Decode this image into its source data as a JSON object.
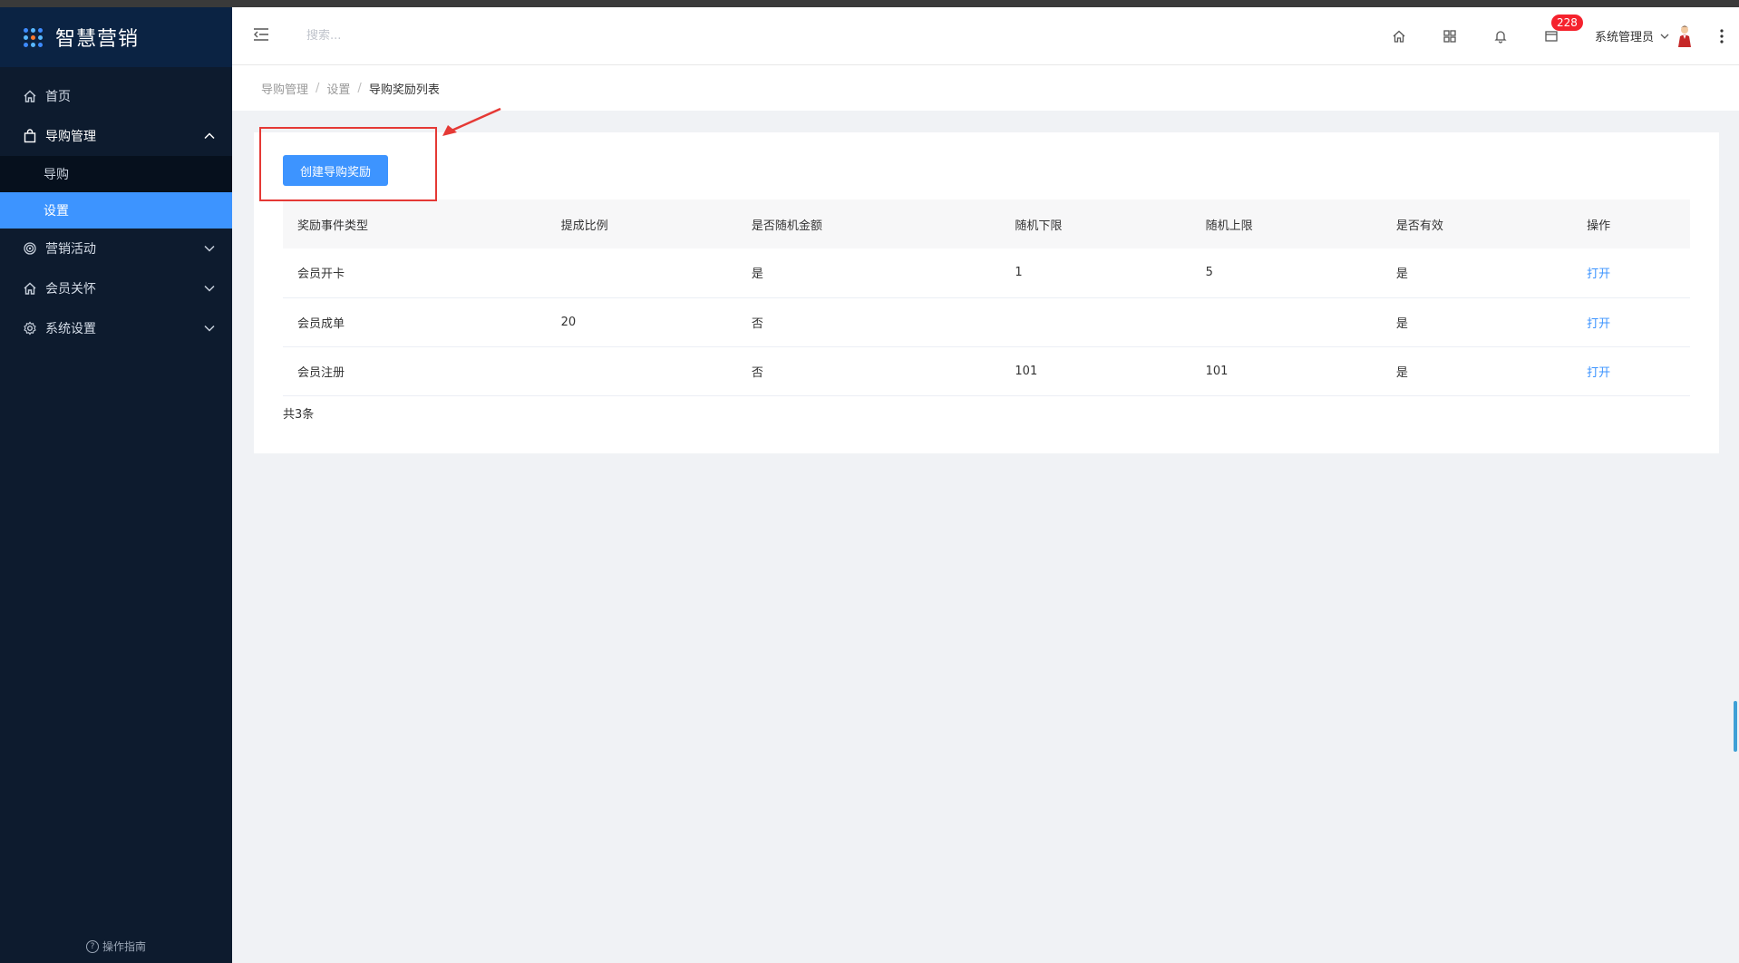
{
  "app": {
    "title": "智慧营销"
  },
  "sidebar": {
    "items": [
      {
        "label": "首页",
        "icon": "home-icon"
      },
      {
        "label": "导购管理",
        "icon": "bag-icon",
        "expanded": true,
        "children": [
          {
            "label": "导购"
          },
          {
            "label": "设置",
            "active": true
          }
        ]
      },
      {
        "label": "营销活动",
        "icon": "target-icon"
      },
      {
        "label": "会员关怀",
        "icon": "home-icon"
      },
      {
        "label": "系统设置",
        "icon": "gear-icon"
      }
    ],
    "guide": "操作指南"
  },
  "header": {
    "search_placeholder": "搜索...",
    "badge_count": "228",
    "user_name": "系统管理员"
  },
  "breadcrumb": {
    "items": [
      "导购管理",
      "设置"
    ],
    "current": "导购奖励列表"
  },
  "main": {
    "create_button": "创建导购奖励",
    "table": {
      "headers": [
        "奖励事件类型",
        "提成比例",
        "是否随机金额",
        "随机下限",
        "随机上限",
        "是否有效",
        "操作"
      ],
      "rows": [
        [
          "会员开卡",
          "",
          "是",
          "1",
          "5",
          "是",
          "打开"
        ],
        [
          "会员成单",
          "20",
          "否",
          "",
          "",
          "是",
          "打开"
        ],
        [
          "会员注册",
          "",
          "否",
          "101",
          "101",
          "是",
          "打开"
        ]
      ]
    },
    "total": "共3条"
  },
  "colors": {
    "sidebar_bg": "#0d1b2e",
    "accent": "#3d94ff",
    "annotation": "#e53935",
    "badge": "#f5222d"
  }
}
